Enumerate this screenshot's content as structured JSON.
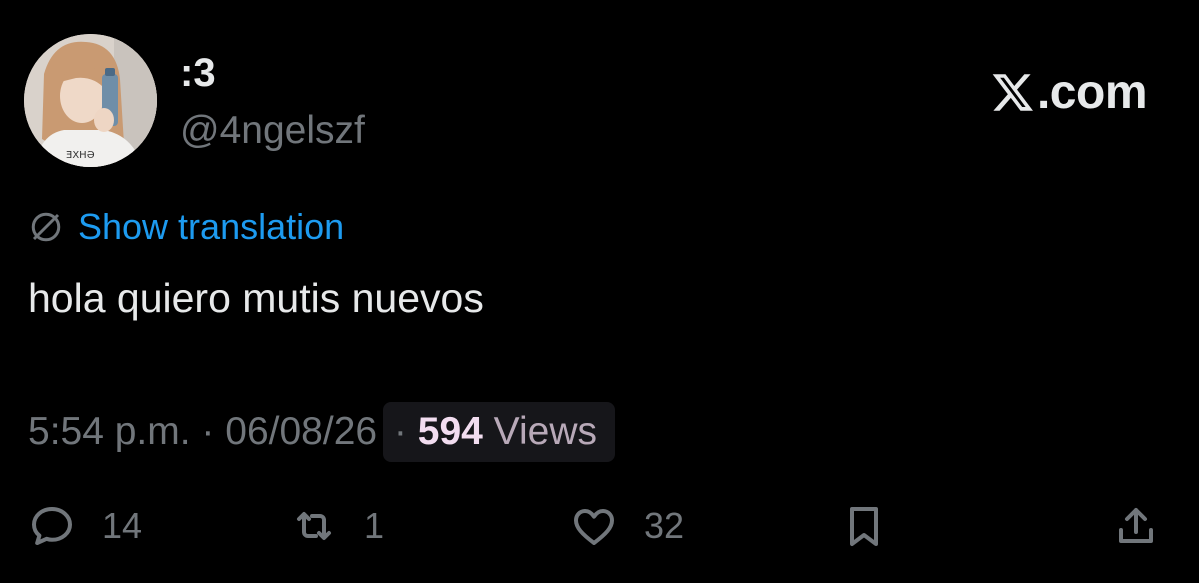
{
  "header": {
    "display_name": ":3",
    "handle": "@4ngelszf",
    "brand_suffix": ".com"
  },
  "tweet": {
    "translate_label": "Show translation",
    "text": "hola quiero mutis nuevos"
  },
  "meta": {
    "time": "5:54 p.m.",
    "sep1": " · ",
    "date": "06/08/26",
    "sep2": " · ",
    "views_count": "594",
    "views_label": " Views"
  },
  "actions": {
    "reply_count": "14",
    "repost_count": "1",
    "like_count": "32"
  },
  "icons": {
    "avatar": "avatar-photo",
    "brand": "x-logo-icon",
    "translate": "globe-icon",
    "reply": "reply-icon",
    "repost": "repost-icon",
    "like": "heart-icon",
    "bookmark": "bookmark-icon",
    "share": "share-icon"
  },
  "colors": {
    "background": "#000000",
    "primary_text": "#e7e9ea",
    "secondary_text": "#71767b",
    "link": "#1d9bf0",
    "views_count": "#f2ddf0"
  }
}
